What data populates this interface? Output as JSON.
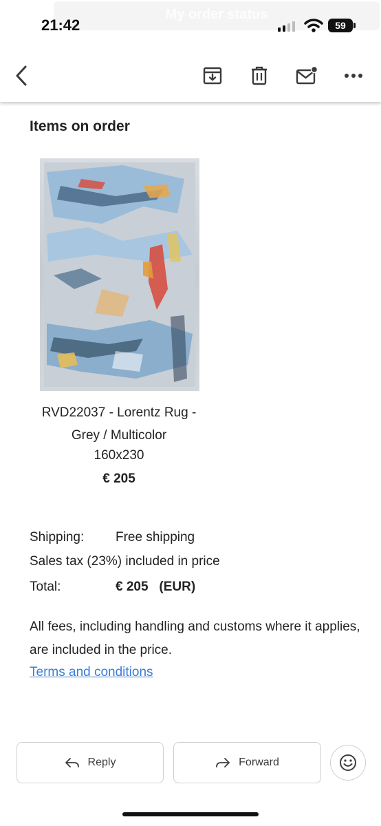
{
  "status_bar": {
    "time": "21:42",
    "notification": "My order status",
    "battery": "59",
    "icons": [
      "signal-icon",
      "wifi-icon",
      "battery-icon"
    ]
  },
  "toolbar": {
    "icons": [
      "back-arrow-icon",
      "archive-icon",
      "delete-icon",
      "mark-unread-icon",
      "more-icon"
    ]
  },
  "order": {
    "section_title": "Items on order",
    "product": {
      "name": "RVD22037 - Lorentz Rug - Grey / Multicolor",
      "size": "160x230",
      "price": "€ 205"
    },
    "summary": {
      "shipping_label": "Shipping:",
      "shipping_value": "Free shipping",
      "tax_text": "Sales tax (23%) included in price",
      "total_label": "Total:",
      "total_value": "€ 205   (EUR)"
    },
    "fees_text": "All fees, including handling and customs where it applies, are included in the price.",
    "terms_link": "Terms and conditions"
  },
  "actions": {
    "reply_label": "Reply",
    "forward_label": "Forward",
    "icons": [
      "reply-icon",
      "forward-icon",
      "emoji-icon"
    ]
  },
  "colors": {
    "link": "#3a7dd6",
    "text": "#222222",
    "border": "#cfcfcf"
  }
}
